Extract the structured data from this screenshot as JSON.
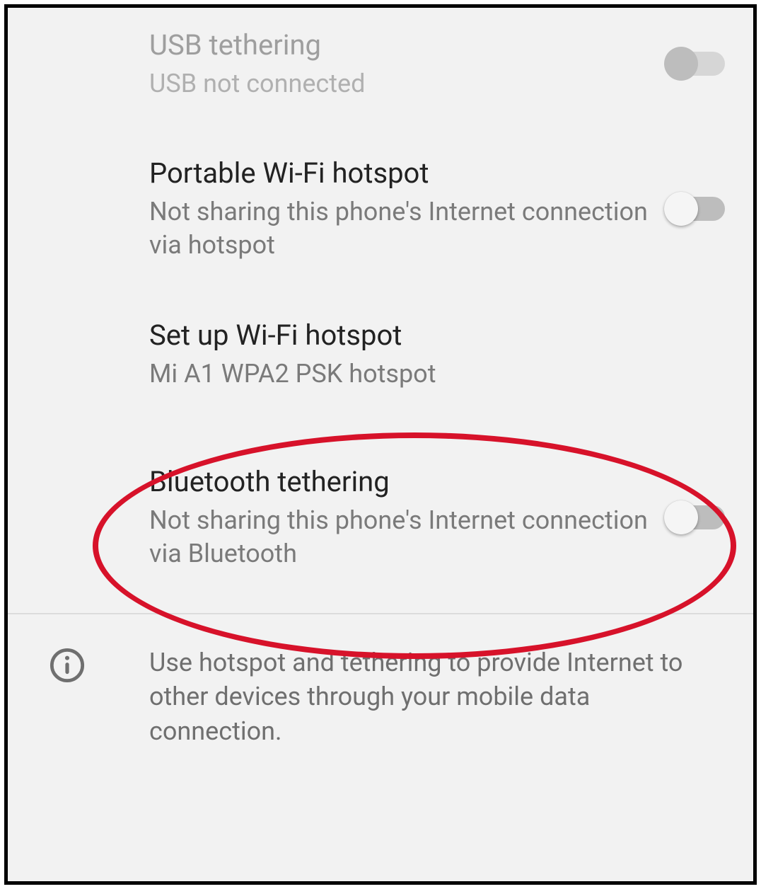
{
  "items": {
    "usb": {
      "title": "USB tethering",
      "subtitle": "USB not connected",
      "enabled": false,
      "checked": false
    },
    "wifi_hotspot": {
      "title": "Portable Wi-Fi hotspot",
      "subtitle": "Not sharing this phone's Internet connection via hotspot",
      "enabled": true,
      "checked": false
    },
    "setup_hotspot": {
      "title": "Set up Wi-Fi hotspot",
      "subtitle": "Mi A1 WPA2 PSK hotspot"
    },
    "bluetooth": {
      "title": "Bluetooth tethering",
      "subtitle": "Not sharing this phone's Internet connection via Bluetooth",
      "enabled": true,
      "checked": false
    }
  },
  "info": {
    "text": "Use hotspot and tethering to provide Internet to other devices through your mobile data connection."
  },
  "annotation": {
    "highlight": "bluetooth-tethering-row",
    "color": "#d7122a"
  }
}
